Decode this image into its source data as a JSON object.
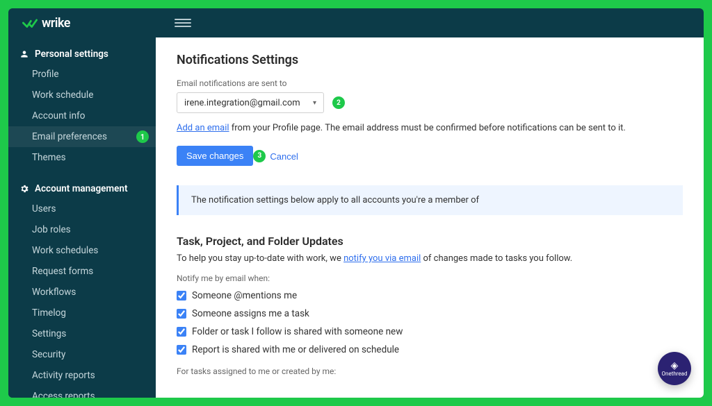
{
  "brand": "wrike",
  "sidebar": {
    "personal": {
      "title": "Personal settings",
      "items": [
        {
          "label": "Profile"
        },
        {
          "label": "Work schedule"
        },
        {
          "label": "Account info"
        },
        {
          "label": "Email preferences",
          "active": true,
          "badge": "1"
        },
        {
          "label": "Themes"
        }
      ]
    },
    "account": {
      "title": "Account management",
      "items": [
        {
          "label": "Users"
        },
        {
          "label": "Job roles"
        },
        {
          "label": "Work schedules"
        },
        {
          "label": "Request forms"
        },
        {
          "label": "Workflows"
        },
        {
          "label": "Timelog"
        },
        {
          "label": "Settings"
        },
        {
          "label": "Security"
        },
        {
          "label": "Activity reports"
        },
        {
          "label": "Access reports"
        }
      ]
    }
  },
  "page": {
    "title": "Notifications Settings",
    "email_label": "Email notifications are sent to",
    "email_value": "irene.integration@gmail.com",
    "hint_link": "Add an email",
    "hint_rest": " from your Profile page. The email address must be confirmed before notifications can be sent to it.",
    "save": "Save changes",
    "cancel": "Cancel",
    "banner": "The notification settings below apply to all accounts you're a member of",
    "section_title": "Task, Project, and Folder Updates",
    "section_blurb_pre": "To help you stay up-to-date with work, we ",
    "section_blurb_link": "notify you via email",
    "section_blurb_post": " of changes made to tasks you follow.",
    "notify_label": "Notify me by email when:",
    "checks": [
      "Someone @mentions me",
      "Someone assigns me a task",
      "Folder or task I follow is shared with someone new",
      "Report is shared with me or delivered on schedule"
    ],
    "tasks_label": "For tasks assigned to me or created by me:"
  },
  "annotations": {
    "a2": "2",
    "a3": "3"
  },
  "floating_logo": "Onethread"
}
